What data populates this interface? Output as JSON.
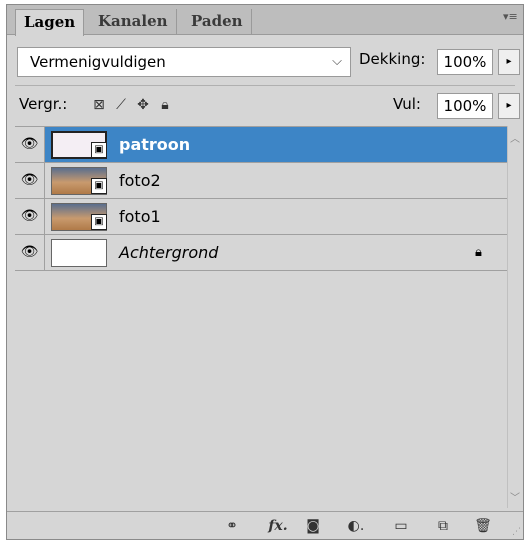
{
  "tabs": [
    {
      "label": "Lagen",
      "active": true
    },
    {
      "label": "Kanalen",
      "active": false
    },
    {
      "label": "Paden",
      "active": false
    }
  ],
  "blend": {
    "mode": "Vermenigvuldigen",
    "opacity_label": "Dekking:",
    "opacity_value": "100%"
  },
  "lock": {
    "label": "Vergr.:",
    "icons": [
      "lock-transparent-icon",
      "lock-pixels-icon",
      "lock-position-icon",
      "lock-all-icon"
    ]
  },
  "fill": {
    "label": "Vul:",
    "value": "100%"
  },
  "layers": [
    {
      "name": "patroon",
      "selected": true,
      "thumb": "pattern",
      "smart_object": true
    },
    {
      "name": "foto2",
      "selected": false,
      "thumb": "photo",
      "smart_object": true
    },
    {
      "name": "foto1",
      "selected": false,
      "thumb": "photo",
      "smart_object": true
    },
    {
      "name": "Achtergrond",
      "selected": false,
      "thumb": "white",
      "italic": true,
      "locked": true
    }
  ],
  "toolbar_icons": [
    "link-layers-icon",
    "fx-icon",
    "layer-mask-icon",
    "adjustment-layer-icon",
    "new-group-icon",
    "new-layer-icon",
    "trash-icon"
  ],
  "colors": {
    "selected_row": "#3d85c6",
    "panel_bg": "#d6d6d6"
  }
}
